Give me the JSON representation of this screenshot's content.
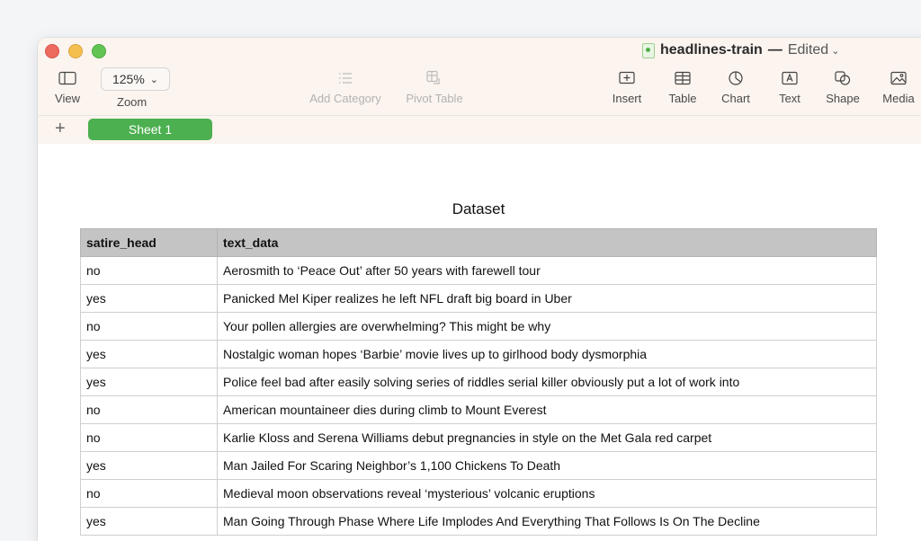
{
  "window": {
    "doc_title": "headlines-train",
    "title_separator": "—",
    "doc_status": "Edited"
  },
  "toolbar": {
    "view_label": "View",
    "zoom_value": "125%",
    "zoom_label": "Zoom",
    "add_category_label": "Add Category",
    "pivot_table_label": "Pivot Table",
    "insert_label": "Insert",
    "table_label": "Table",
    "chart_label": "Chart",
    "text_label": "Text",
    "shape_label": "Shape",
    "media_label": "Media"
  },
  "sheets": {
    "add_symbol": "+",
    "active_tab": "Sheet 1"
  },
  "table": {
    "title": "Dataset",
    "headers": [
      "satire_head",
      "text_data"
    ],
    "rows": [
      [
        "no",
        "Aerosmith to ‘Peace Out’ after 50 years with farewell tour"
      ],
      [
        "yes",
        "Panicked Mel Kiper realizes he left NFL draft big board in Uber"
      ],
      [
        "no",
        "Your pollen allergies are overwhelming? This might be why"
      ],
      [
        "yes",
        "Nostalgic woman hopes ‘Barbie’ movie lives up to girlhood body dysmorphia"
      ],
      [
        "yes",
        "Police feel bad after easily solving series of riddles serial killer obviously put a lot of work into"
      ],
      [
        "no",
        "American mountaineer dies during climb to Mount Everest"
      ],
      [
        "no",
        "Karlie Kloss and Serena Williams debut pregnancies in style on the Met Gala red carpet"
      ],
      [
        "yes",
        "Man Jailed For Scaring Neighbor’s 1,100 Chickens To Death"
      ],
      [
        "no",
        "Medieval moon observations reveal ‘mysterious’ volcanic eruptions"
      ],
      [
        "yes",
        "Man Going Through Phase Where Life Implodes And Everything That Follows Is On The Decline"
      ]
    ]
  },
  "colors": {
    "accent_tab": "#4caf50",
    "header_fill": "#c3c4c3",
    "toolbar_bg": "#fbf4ef"
  }
}
